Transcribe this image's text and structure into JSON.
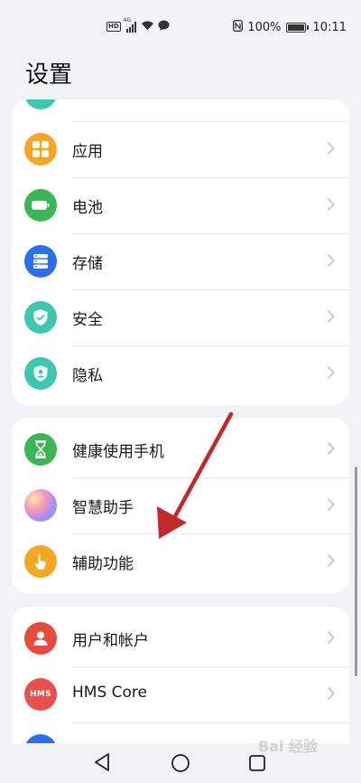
{
  "status_bar": {
    "network_badge": "HD",
    "signal_type": "4G",
    "battery_percent": "100%",
    "time": "10:11",
    "icons": [
      "hd-icon",
      "signal-icon",
      "wifi-icon",
      "message-icon",
      "nfc-icon",
      "battery-icon"
    ]
  },
  "page": {
    "title": "设置"
  },
  "groups": [
    {
      "items": [
        {
          "label": "应用",
          "icon": "apps-icon",
          "color": "#f5a623"
        },
        {
          "label": "电池",
          "icon": "battery-icon",
          "color": "#3cb554"
        },
        {
          "label": "存储",
          "icon": "storage-icon",
          "color": "#2a6ff0"
        },
        {
          "label": "安全",
          "icon": "shield-check-icon",
          "color": "#3cc7b1"
        },
        {
          "label": "隐私",
          "icon": "privacy-shield-icon",
          "color": "#3cc7b1"
        }
      ]
    },
    {
      "items": [
        {
          "label": "健康使用手机",
          "icon": "hourglass-icon",
          "color": "#3cb554"
        },
        {
          "label": "智慧助手",
          "icon": "assistant-orb-icon",
          "color": "#b28cf2"
        },
        {
          "label": "辅助功能",
          "icon": "hand-pointer-icon",
          "color": "#f5a623"
        }
      ]
    },
    {
      "items": [
        {
          "label": "用户和帐户",
          "icon": "user-icon",
          "color": "#e84a3c"
        },
        {
          "label": "HMS Core",
          "icon": "hms-icon",
          "color": "#e85050",
          "icon_text": "HMS"
        }
      ]
    }
  ],
  "navigation": {
    "buttons": [
      "back-icon",
      "home-icon",
      "recent-apps-icon"
    ]
  },
  "watermark": {
    "text": "Bai 经验"
  },
  "annotation": {
    "type": "red-arrow",
    "color": "#c22a2a",
    "points_to": "辅助功能"
  }
}
